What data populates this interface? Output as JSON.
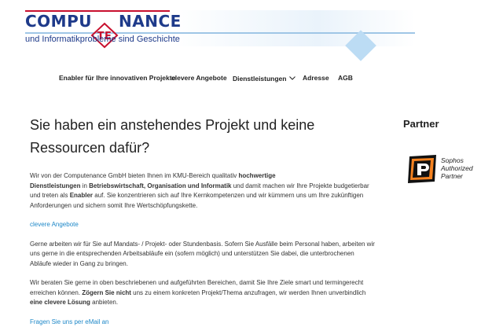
{
  "header": {
    "logo_prefix": "COMPU",
    "logo_suffix": "NANCE",
    "logo_mark": "TE",
    "tagline": "und Informatikprobleme sind Geschichte",
    "colors": {
      "brand_blue": "#1e3a8a",
      "brand_red": "#c8102e",
      "light_blue": "#bcdcf4"
    }
  },
  "nav": {
    "items": [
      {
        "label": "Enabler für Ihre innovativen Projekte"
      },
      {
        "label": "clevere Angebote"
      },
      {
        "label": "Dienstleistungen",
        "icon": "chevron-down-icon"
      },
      {
        "label": "Adresse"
      },
      {
        "label": "AGB"
      }
    ]
  },
  "main": {
    "title_line1": "Sie haben ein anstehendes Projekt und keine",
    "title_line2": "Ressourcen dafür?",
    "p1": {
      "t1": "Wir von der Computenance GmbH bieten Ihnen im KMU-Bereich qualitativ ",
      "b1": "hochwertige",
      "b2": "Dienstleistungen",
      "t2": " in ",
      "b3": "Betriebswirtschaft, Organisation und Informatik",
      "t3": " und damit machen wir Ihre Projekte budgetierbar und treten als ",
      "b4": "Enabler",
      "t4": " auf. Sie konzentrieren sich auf Ihre Kernkompetenzen und wir kümmern uns um Ihre zukünftigen Anforderungen und sichern somit Ihre Wertschöpfungskette."
    },
    "link1": "clevere Angebote",
    "p2": "Gerne arbeiten wir für Sie auf Mandats- / Projekt- oder Stundenbasis. Sofern Sie Ausfälle beim Personal haben, arbeiten wir uns gerne in die entsprechenden Arbeitsabläufe ein (sofern möglich) und unterstützen Sie dabei, die unterbrochenen Abläufe wieder in Gang zu bringen.",
    "p3": {
      "t1": "Wir beraten Sie gerne in oben beschriebenen und aufgeführten Bereichen, damit Sie Ihre Ziele smart und termingerecht erreichen können. ",
      "b1": "Zögern Sie nicht",
      "t2": " uns zu einem konkreten Projekt/Thema anzufragen, wir werden Ihnen unverbindlich ",
      "b2": "eine clevere Lösung",
      "t3": " anbieten."
    },
    "link2": "Fragen Sie uns per eMail an"
  },
  "sidebar": {
    "title": "Partner",
    "sophos_line1": "Sophos",
    "sophos_line2": "Authorized",
    "sophos_line3": "Partner"
  }
}
